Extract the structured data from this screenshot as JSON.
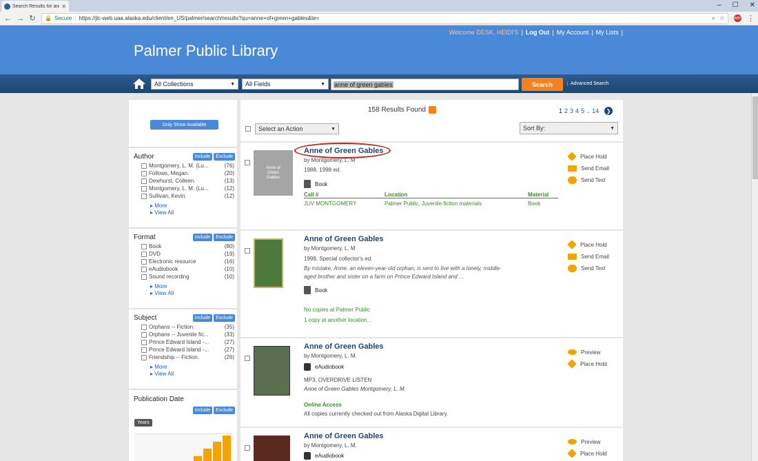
{
  "browser": {
    "tab_title": "Search Results for anne of green gables",
    "secure_label": "Secure",
    "url": "https://jlc-web.uaa.alaska.edu/client/en_US/palmer/search/results?qu=anne+of+green+gables&te="
  },
  "header": {
    "welcome": "Welcome DESK, HEIDI'S",
    "links": [
      "Log Out",
      "My Account",
      "My Lists"
    ],
    "library_name": "Palmer Public Library"
  },
  "search": {
    "collection": "All Collections",
    "field": "All Fields",
    "query": "anne of green gables",
    "button": "Search",
    "advanced": "Advanced Search"
  },
  "sidebar": {
    "only_available": "Only Show Available",
    "include": "Include",
    "exclude": "Exclude",
    "more": "More",
    "view_all": "View All",
    "facets": [
      {
        "title": "Author",
        "items": [
          {
            "label": "Montgomery, L. M. (Lu...",
            "count": "(76)"
          },
          {
            "label": "Follows, Megan.",
            "count": "(20)"
          },
          {
            "label": "Dewhurst, Colleen.",
            "count": "(13)"
          },
          {
            "label": "Montgomery, L. M. (Lu...",
            "count": "(12)"
          },
          {
            "label": "Sullivan, Kevin.",
            "count": "(12)"
          }
        ]
      },
      {
        "title": "Format",
        "items": [
          {
            "label": "Book",
            "count": "(80)"
          },
          {
            "label": "DVD",
            "count": "(19)"
          },
          {
            "label": "Electronic resource",
            "count": "(16)"
          },
          {
            "label": "eAudiobook",
            "count": "(10)"
          },
          {
            "label": "Sound recording",
            "count": "(10)"
          }
        ]
      },
      {
        "title": "Subject",
        "items": [
          {
            "label": "Orphans -- Fiction.",
            "count": "(35)"
          },
          {
            "label": "Orphans -- Juvenile fic...",
            "count": "(33)"
          },
          {
            "label": "Prince Edward Island -...",
            "count": "(27)"
          },
          {
            "label": "Prince Edward Island -...",
            "count": "(27)"
          },
          {
            "label": "Friendship -- Fiction.",
            "count": "(26)"
          }
        ]
      }
    ],
    "pubdate_title": "Publication Date",
    "years_label": "Years",
    "year_bar_levels": [
      0.18,
      0.45,
      0.7,
      0.92
    ]
  },
  "results": {
    "found": "158 Results Found",
    "pages": [
      "1",
      "2",
      "3",
      "4",
      "5",
      "..",
      "14"
    ],
    "action_select": "Select an Action",
    "sort_select": "Sort By:",
    "items": [
      {
        "title": "Anne of Green Gables",
        "author": "by Montgomery, L. M",
        "edition": "1988, 1998 ed.",
        "format": "Book",
        "cover_text": "Anne of Green Gables",
        "holdings_head": [
          "Call #",
          "Location",
          "Material"
        ],
        "holdings_row": [
          "JUV MONTGOMERY",
          "Palmer Public, Juvenile fiction materials",
          "Book"
        ],
        "actions": [
          "Place Hold",
          "Send Email",
          "Send Text"
        ]
      },
      {
        "title": "Anne of Green Gables",
        "author": "by Montgomery, L. M",
        "edition": "1998, Special collector's ed.",
        "description": "By mistake, Anne, an eleven-year-old orphan, is sent to live with a lonely, middle-aged brother and sister on a farm on Prince Edward Island and ...",
        "format": "Book",
        "availability": "No copies at Palmer Public",
        "other": "1 copy at another location...",
        "actions": [
          "Place Hold",
          "Send Email",
          "Send Text"
        ]
      },
      {
        "title": "Anne of Green Gables",
        "author": "by  Montgomery, L. M.",
        "format": "eAudiobook",
        "edition": "MP3, OVERDRIVE LISTEN",
        "description": "Anne of Green Gables Montgomery, L. M.",
        "availability": "Online Access",
        "other": "All copies currently checked out from Alaska Digital Library.",
        "actions": [
          "Preview",
          "Place Hold"
        ]
      },
      {
        "title": "Anne of Green Gables",
        "author": "by  Montgomery, L. M.",
        "format": "eAudiobook",
        "actions": [
          "Preview",
          "Place Hold"
        ]
      }
    ]
  }
}
